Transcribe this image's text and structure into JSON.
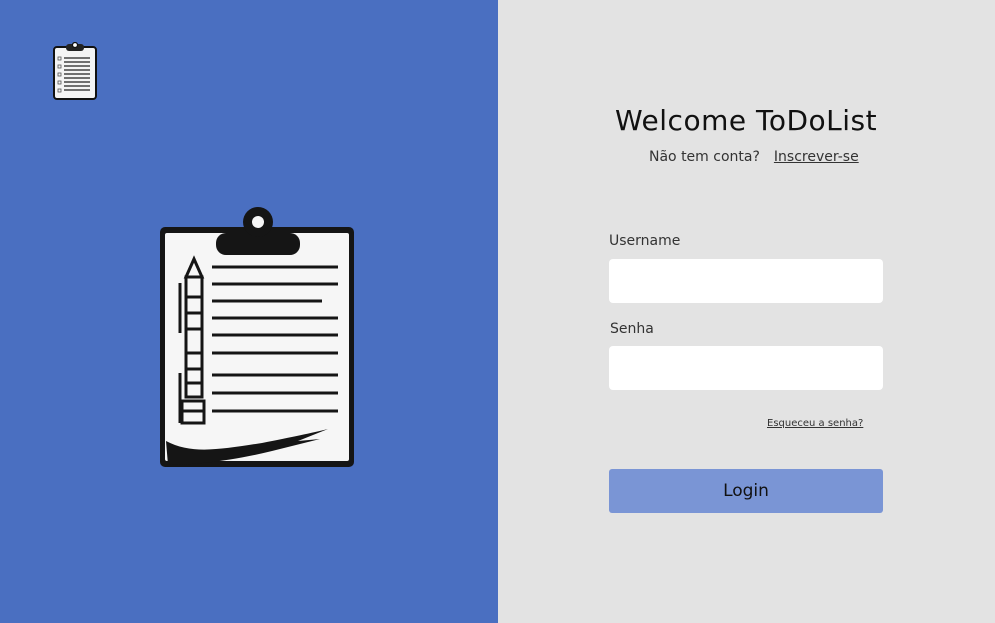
{
  "brand": {
    "logo_icon": "clipboard-list-icon",
    "hero_icon": "clipboard-pencil-icon",
    "panel_color": "#4a6fc1"
  },
  "login": {
    "title": "Welcome ToDoList",
    "signup_prompt": "Não tem conta?",
    "signup_link": "Inscrever-se",
    "username_label": "Username",
    "username_value": "",
    "password_label": "Senha",
    "password_value": "",
    "forgot_link": "Esqueceu a senha?",
    "login_button": "Login",
    "button_color": "#7a95d5"
  }
}
